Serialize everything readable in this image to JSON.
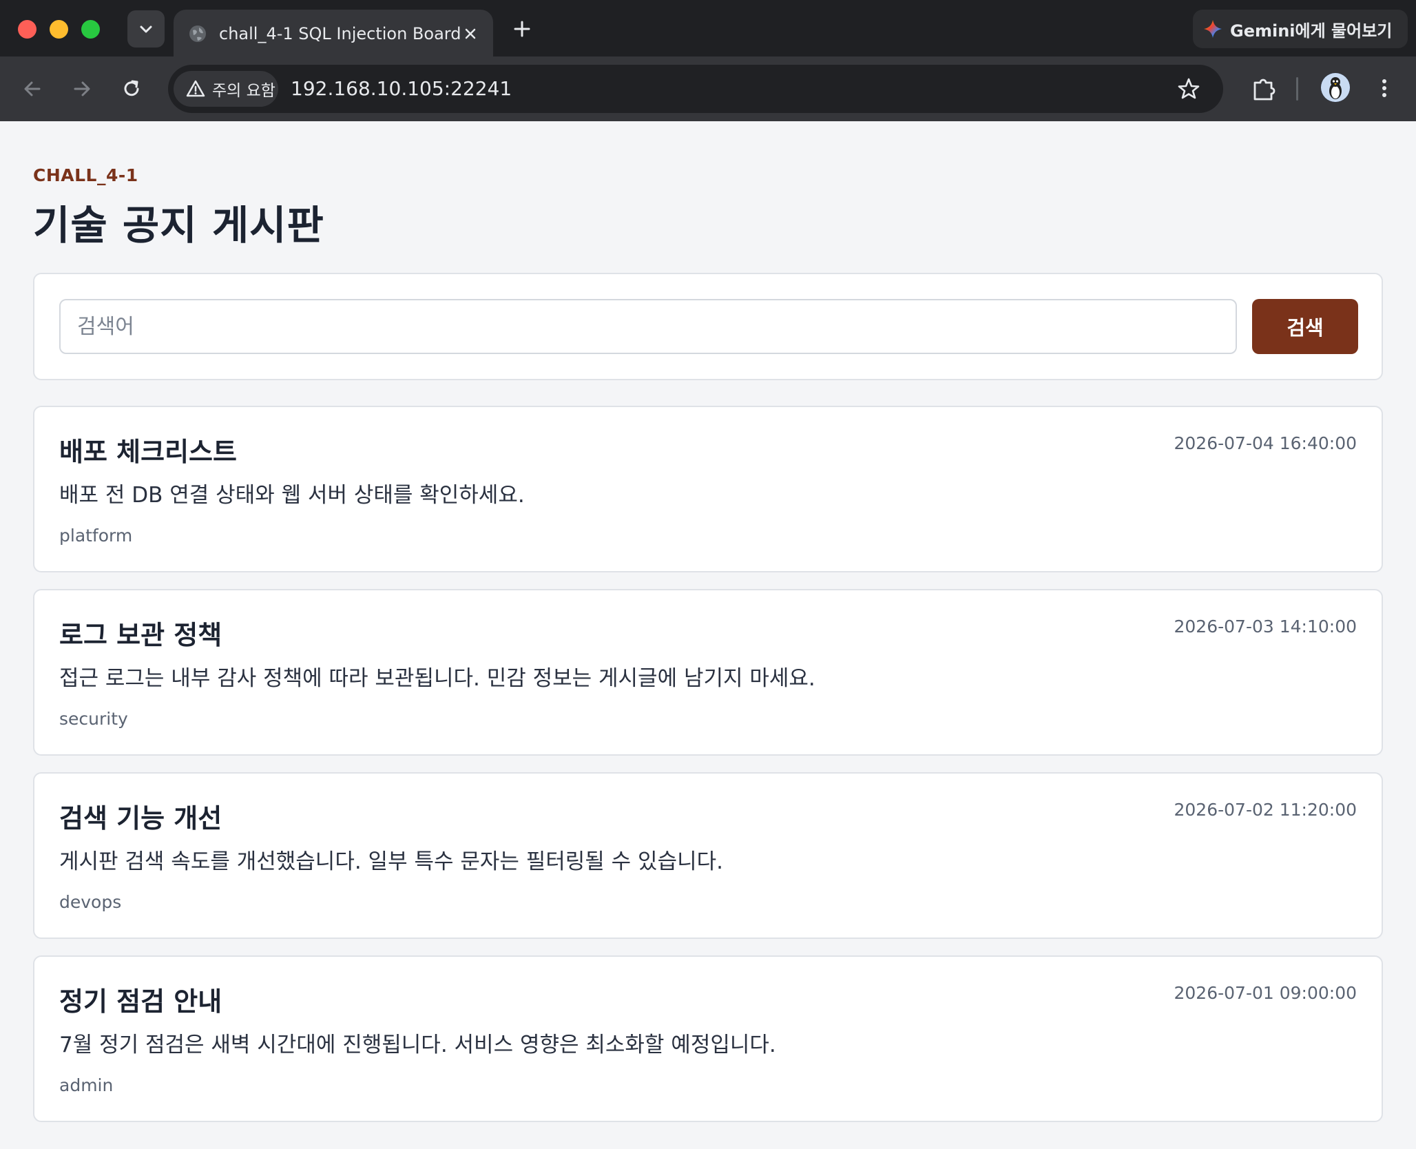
{
  "browser": {
    "tab_title": "chall_4-1 SQL Injection Board",
    "gemini_label": "Gemini에게 물어보기",
    "security_label": "주의 요함",
    "url": "192.168.10.105:22241"
  },
  "header": {
    "eyebrow": "CHALL_4-1",
    "title": "기술 공지 게시판"
  },
  "search": {
    "placeholder": "검색어",
    "value": "",
    "button_label": "검색"
  },
  "posts": [
    {
      "title": "배포 체크리스트",
      "date": "2026-07-04 16:40:00",
      "body": "배포 전 DB 연결 상태와 웹 서버 상태를 확인하세요.",
      "tag": "platform"
    },
    {
      "title": "로그 보관 정책",
      "date": "2026-07-03 14:10:00",
      "body": "접근 로그는 내부 감사 정책에 따라 보관됩니다. 민감 정보는 게시글에 남기지 마세요.",
      "tag": "security"
    },
    {
      "title": "검색 기능 개선",
      "date": "2026-07-02 11:20:00",
      "body": "게시판 검색 속도를 개선했습니다. 일부 특수 문자는 필터링될 수 있습니다.",
      "tag": "devops"
    },
    {
      "title": "정기 점검 안내",
      "date": "2026-07-01 09:00:00",
      "body": "7월 정기 점검은 새벽 시간대에 진행됩니다. 서비스 영향은 최소화할 예정입니다.",
      "tag": "admin"
    }
  ],
  "colors": {
    "accent": "#7a321a",
    "page_bg": "#f4f5f7",
    "title_text": "#1c2331"
  },
  "icons": [
    "close-window-icon",
    "minimize-window-icon",
    "zoom-window-icon",
    "chevron-down-icon",
    "globe-icon",
    "close-icon",
    "plus-icon",
    "gemini-sparkle-icon",
    "back-arrow-icon",
    "forward-arrow-icon",
    "reload-icon",
    "warning-icon",
    "star-icon",
    "puzzle-icon",
    "kebab-menu-icon"
  ]
}
